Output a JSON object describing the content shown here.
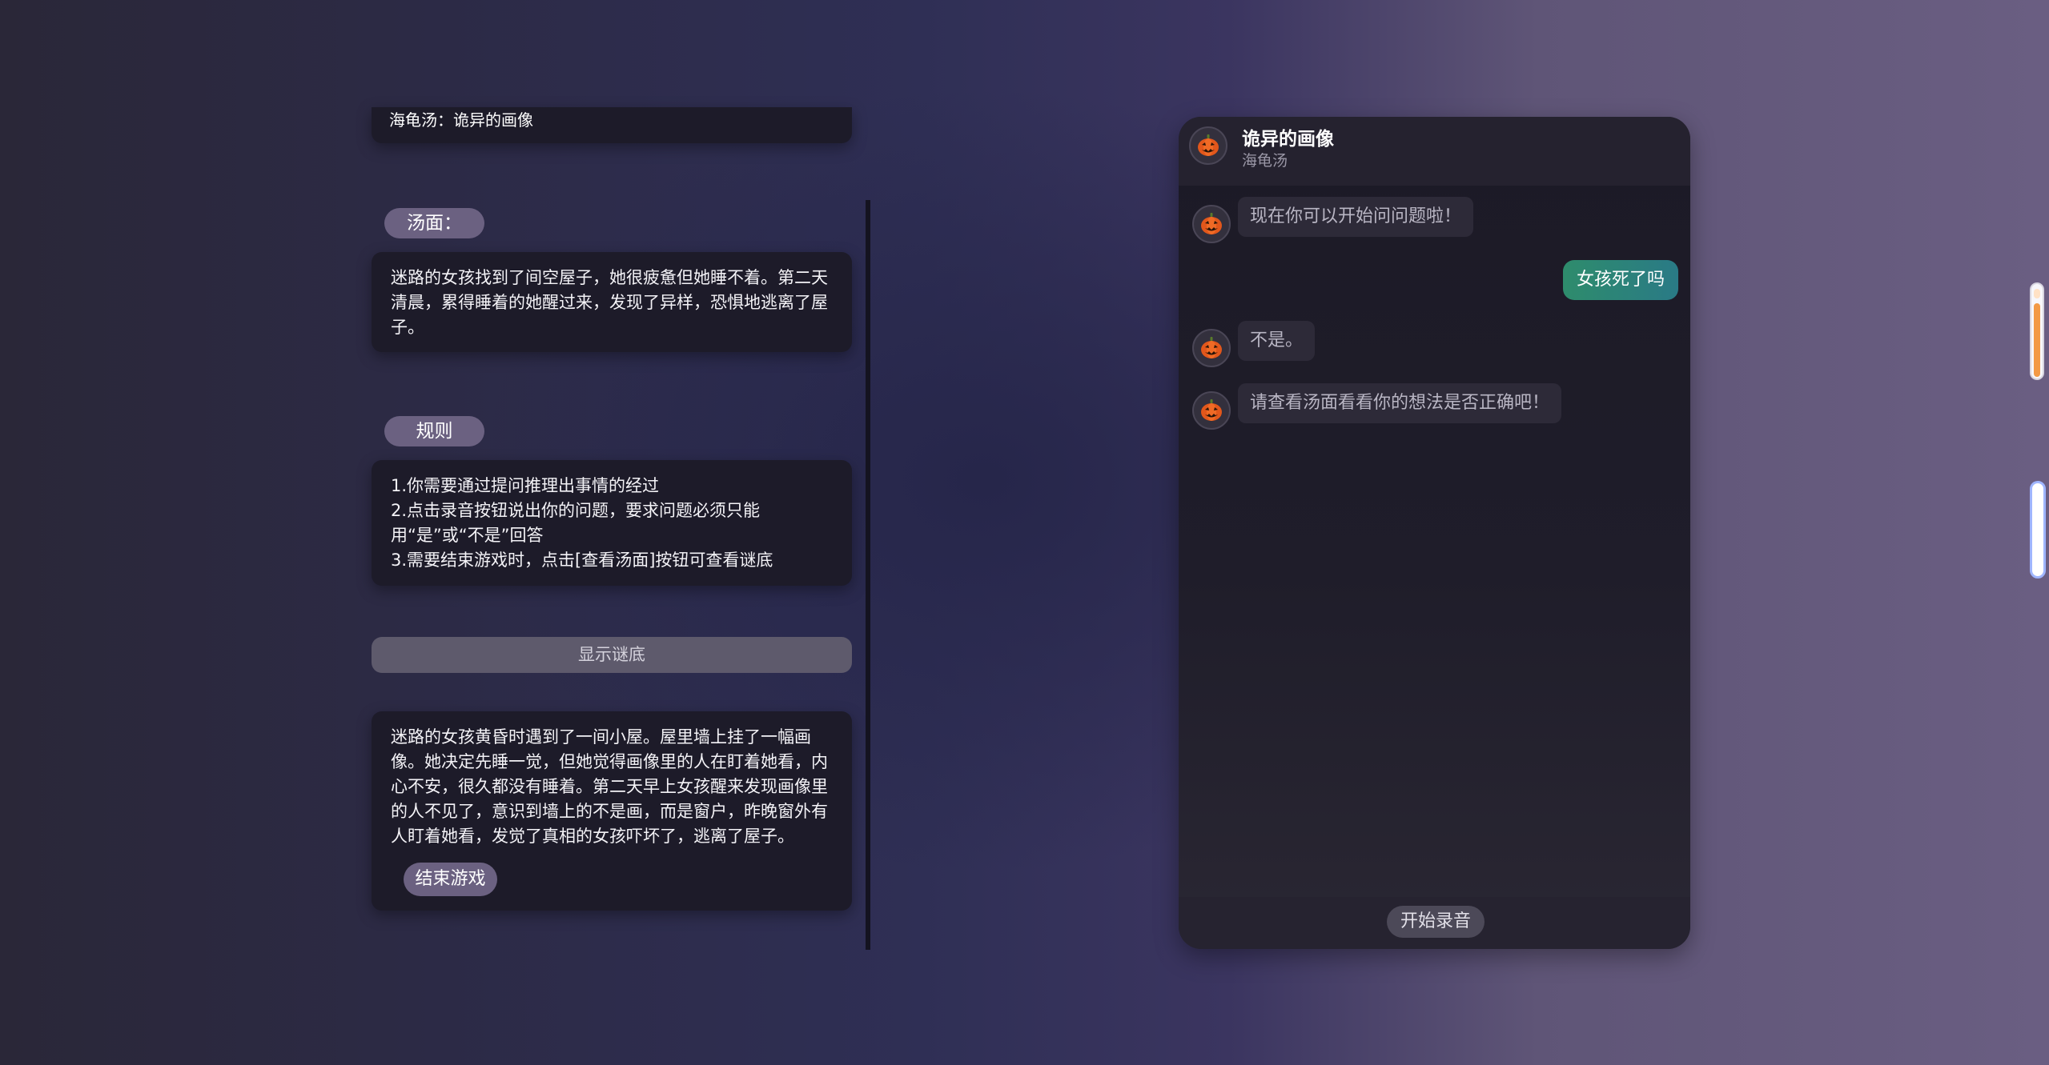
{
  "left_panel": {
    "top_card_text": "海龟汤：诡异的画像",
    "soup_label": "汤面：",
    "soup_text": "迷路的女孩找到了间空屋子，她很疲惫但她睡不着。第二天清晨，累得睡着的她醒过来，发现了异样，恐惧地逃离了屋子。",
    "rules_label": "规则",
    "rules": [
      "1.你需要通过提问推理出事情的经过",
      "2.点击录音按钮说出你的问题，要求问题必须只能用“是”或“不是”回答",
      "3.需要结束游戏时，点击[查看汤面]按钮可查看谜底"
    ],
    "reveal_button": "显示谜底",
    "answer_text": "迷路的女孩黄昏时遇到了一间小屋。屋里墙上挂了一幅画像。她决定先睡一觉，但她觉得画像里的人在盯着她看，内心不安，很久都没有睡着。第二天早上女孩醒来发现画像里的人不见了，意识到墙上的不是画，而是窗户，昨晚窗外有人盯着她看，发觉了真相的女孩吓坏了，逃离了屋子。",
    "end_button": "结束游戏"
  },
  "chat": {
    "title": "诡异的画像",
    "subtitle": "海龟汤",
    "avatar_icon": "jack-o-lantern-icon",
    "messages": [
      {
        "from": "bot",
        "text": "现在你可以开始问问题啦！"
      },
      {
        "from": "user",
        "text": "女孩死了吗"
      },
      {
        "from": "bot",
        "text": "不是。"
      },
      {
        "from": "bot",
        "text": "请查看汤面看看你的想法是否正确吧！"
      }
    ],
    "record_button": "开始录音"
  },
  "colors": {
    "pill": "#6b6181",
    "card": "#1d1b29",
    "user_bubble": "#2e8c6c",
    "bot_bubble": "#2d2a38",
    "scrollbar_accent": "#f39a46"
  }
}
